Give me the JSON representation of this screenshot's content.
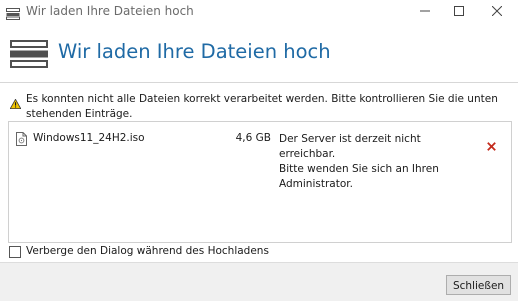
{
  "window": {
    "title": "Wir laden Ihre Dateien hoch",
    "app_icon": "upload-app-icon",
    "controls": [
      "minimize-icon",
      "maximize-icon",
      "close-icon"
    ]
  },
  "header": {
    "heading": "Wir laden Ihre Dateien hoch",
    "icon": "upload-stack-icon",
    "heading_color": "#1f6aa5"
  },
  "warning": {
    "icon": "warning-icon",
    "text": "Es konnten nicht alle Dateien korrekt verarbeitet werden. Bitte kontrollieren Sie die unten stehenden Einträge."
  },
  "files": [
    {
      "icon": "file-icon",
      "name": "Windows11_24H2.iso",
      "size": "4,6 GB",
      "error": "Der Server ist derzeit nicht erreichbar.\nBitte wenden Sie sich an Ihren\nAdministrator.",
      "remove_icon": "remove-x-icon",
      "remove_color": "#c42b1c"
    }
  ],
  "options": {
    "hide_dialog_label": "Verberge den Dialog während des Hochladens",
    "hide_dialog_checked": false
  },
  "footer": {
    "close_label": "Schließen"
  }
}
